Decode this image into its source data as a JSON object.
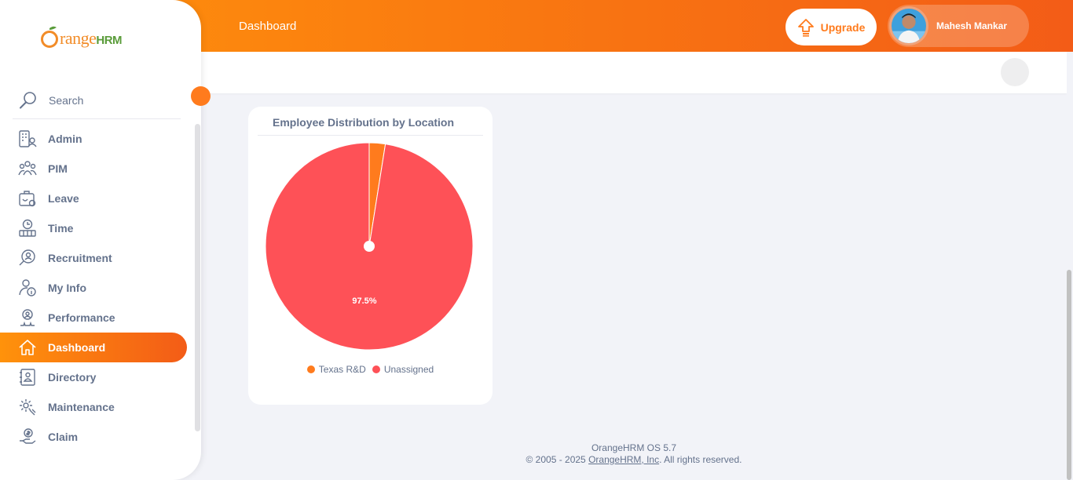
{
  "header": {
    "page_title": "Dashboard",
    "upgrade_label": "Upgrade",
    "user_name": "Mahesh Mankar"
  },
  "sidebar": {
    "logo_prefix": "range",
    "logo_suffix": "HRM",
    "search_placeholder": "Search",
    "items": [
      {
        "label": "Admin",
        "icon": "admin-icon",
        "active": false
      },
      {
        "label": "PIM",
        "icon": "pim-icon",
        "active": false
      },
      {
        "label": "Leave",
        "icon": "leave-icon",
        "active": false
      },
      {
        "label": "Time",
        "icon": "time-icon",
        "active": false
      },
      {
        "label": "Recruitment",
        "icon": "recruitment-icon",
        "active": false
      },
      {
        "label": "My Info",
        "icon": "my-info-icon",
        "active": false
      },
      {
        "label": "Performance",
        "icon": "performance-icon",
        "active": false
      },
      {
        "label": "Dashboard",
        "icon": "home-icon",
        "active": true
      },
      {
        "label": "Directory",
        "icon": "directory-icon",
        "active": false
      },
      {
        "label": "Maintenance",
        "icon": "maintenance-icon",
        "active": false
      },
      {
        "label": "Claim",
        "icon": "claim-icon",
        "active": false
      }
    ]
  },
  "widget": {
    "title": "Employee Distribution by Location",
    "slice_label": "97.5%"
  },
  "chart_data": {
    "type": "pie",
    "title": "Employee Distribution by Location",
    "categories": [
      "Texas R&D",
      "Unassigned"
    ],
    "values": [
      2.5,
      97.5
    ],
    "colors": [
      "#ff7b1d",
      "#fe5157"
    ],
    "legend": "bottom"
  },
  "footer": {
    "version": "OrangeHRM OS 5.7",
    "copyright_prefix": "© 2005 - 2025 ",
    "company_link": "OrangeHRM, Inc",
    "copyright_suffix": ". All rights reserved."
  },
  "colors": {
    "accent": "#ff7b1d",
    "gradient_start": "#ff920b",
    "gradient_end": "#f35c17",
    "text": "#64728c"
  }
}
